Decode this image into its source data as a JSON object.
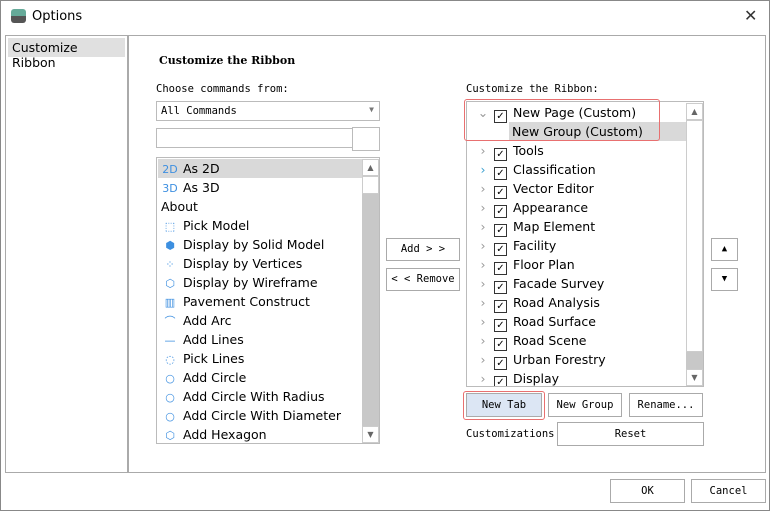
{
  "window": {
    "title": "Options",
    "close": "✕"
  },
  "sidebar": {
    "items": [
      {
        "label": "Customize Ribbon"
      }
    ]
  },
  "main": {
    "heading": "Customize the Ribbon",
    "commands_label": "Choose commands from:",
    "commands_select": "All Commands",
    "search_value": "",
    "commands": [
      {
        "icon": "2D",
        "label": "As 2D",
        "selected": true
      },
      {
        "icon": "3D",
        "label": "As 3D"
      },
      {
        "icon": "",
        "label": "About"
      },
      {
        "icon": "⬚",
        "label": "Pick Model"
      },
      {
        "icon": "⬢",
        "label": "Display by Solid Model"
      },
      {
        "icon": "⁘",
        "label": "Display by Vertices"
      },
      {
        "icon": "⬡",
        "label": "Display by Wireframe"
      },
      {
        "icon": "▥",
        "label": "Pavement Construct"
      },
      {
        "icon": "⌒",
        "label": "Add Arc"
      },
      {
        "icon": "—",
        "label": "Add Lines"
      },
      {
        "icon": "◌",
        "label": "Pick Lines"
      },
      {
        "icon": "○",
        "label": "Add Circle"
      },
      {
        "icon": "○",
        "label": "Add Circle With Radius"
      },
      {
        "icon": "○",
        "label": "Add Circle With Diameter"
      },
      {
        "icon": "⬡",
        "label": "Add Hexagon"
      }
    ],
    "add_button": "Add > >",
    "remove_button": "< < Remove",
    "ribbon_label": "Customize the Ribbon:",
    "ribbon": [
      {
        "label": "New Page (Custom)",
        "expanded": true,
        "checked": true
      },
      {
        "label": "New Group (Custom)",
        "child": true,
        "selected": true
      },
      {
        "label": "Tools",
        "checked": true
      },
      {
        "label": "Classification",
        "checked": true
      },
      {
        "label": "Vector Editor",
        "checked": true
      },
      {
        "label": "Appearance",
        "checked": true
      },
      {
        "label": "Map Element",
        "checked": true
      },
      {
        "label": "Facility",
        "checked": true
      },
      {
        "label": "Floor Plan",
        "checked": true
      },
      {
        "label": "Facade Survey",
        "checked": true
      },
      {
        "label": "Road Analysis",
        "checked": true
      },
      {
        "label": "Road Surface",
        "checked": true
      },
      {
        "label": "Road Scene",
        "checked": true
      },
      {
        "label": "Urban Forestry",
        "checked": true
      },
      {
        "label": "Display",
        "checked": true
      }
    ],
    "new_tab": "New Tab",
    "new_group": "New Group",
    "rename": "Rename...",
    "customizations_label": "Customizations:",
    "reset": "Reset"
  },
  "footer": {
    "ok": "OK",
    "cancel": "Cancel"
  },
  "colors": {
    "highlight": "#e87070",
    "selection": "#d9d9d9",
    "new_tab_bg": "#dce6f4",
    "icon_blue": "#3d8fe0"
  }
}
